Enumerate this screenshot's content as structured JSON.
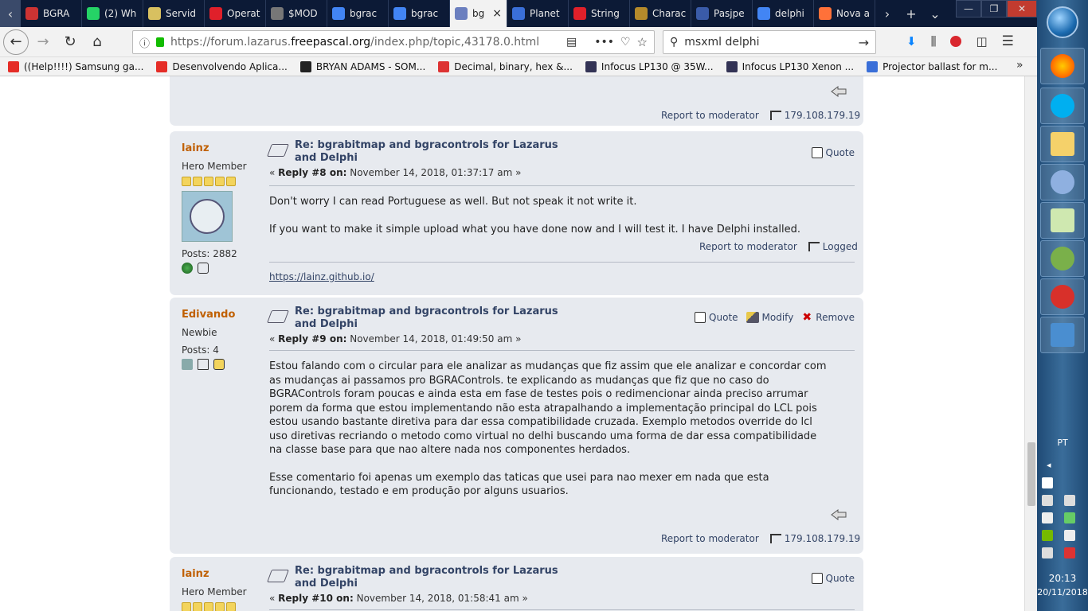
{
  "browser": {
    "tabs": [
      {
        "label": "BGRA",
        "color": "#c33"
      },
      {
        "label": "(2) Wh",
        "color": "#25d366"
      },
      {
        "label": "Servid",
        "color": "#d8c060"
      },
      {
        "label": "Operat",
        "color": "#e0202a"
      },
      {
        "label": "$MOD",
        "color": "#777"
      },
      {
        "label": "bgrac",
        "color": "#4285f4"
      },
      {
        "label": "bgrac",
        "color": "#4285f4"
      },
      {
        "label": "bg",
        "color": "#6b7fbf",
        "active": true
      },
      {
        "label": "Planet",
        "color": "#3a6fd8"
      },
      {
        "label": "String",
        "color": "#e0202a"
      },
      {
        "label": "Charac",
        "color": "#b58a2b"
      },
      {
        "label": "Pasjpe",
        "color": "#3a5ba8"
      },
      {
        "label": "delphi",
        "color": "#4285f4"
      },
      {
        "label": "Nova a",
        "color": "#ff7139"
      }
    ],
    "close_tab": "×",
    "new_tab": "+",
    "url_prefix": "https://forum.lazarus.",
    "url_domain": "freepascal.org",
    "url_suffix": "/index.php/topic,43178.0.html",
    "search_value": "msxml delphi",
    "bookmarks": [
      {
        "label": "((Help!!!!) Samsung ga...",
        "color": "#e52d27"
      },
      {
        "label": "Desenvolvendo Aplica...",
        "color": "#e52d27"
      },
      {
        "label": "BRYAN ADAMS - SOM...",
        "color": "#222"
      },
      {
        "label": "Decimal, binary, hex &...",
        "color": "#d33"
      },
      {
        "label": "Infocus LP130 @ 35W...",
        "color": "#335"
      },
      {
        "label": "Infocus LP130 Xenon ...",
        "color": "#335"
      },
      {
        "label": "Projector ballast for m...",
        "color": "#3a6fd8"
      }
    ]
  },
  "forum": {
    "top_report": "Report to moderator",
    "top_ip": "179.108.179.19",
    "posts": [
      {
        "name": "lainz",
        "rank": "Hero Member",
        "posts": "Posts: 2882",
        "subject": "Re: bgrabitmap and bgracontrols for Lazarus and Delphi",
        "reply_label": "Reply #8 on:",
        "reply_date": "November 14, 2018, 01:37:17 am",
        "quote": "Quote",
        "body1": "Don't worry I can read Portuguese as well. But not speak it not write it.",
        "body2": "If you want to make it simple upload what you have done now and I will test it. I have Delphi installed.",
        "report": "Report to moderator",
        "logged": "Logged",
        "signature": "https://lainz.github.io/"
      },
      {
        "name": "Edivando",
        "rank": "Newbie",
        "posts": "Posts: 4",
        "subject": "Re: bgrabitmap and bgracontrols for Lazarus and Delphi",
        "reply_label": "Reply #9 on:",
        "reply_date": "November 14, 2018, 01:49:50 am",
        "quote": "Quote",
        "modify": "Modify",
        "remove": "Remove",
        "body1": "Estou falando com o circular para ele analizar as mudanças que fiz assim que ele analizar e concordar com as mudanças ai passamos pro BGRAControls. te explicando as mudanças que fiz que no caso do BGRAControls foram poucas e ainda esta em fase de testes pois o redimencionar ainda preciso arrumar porem da forma que estou implementando não esta atrapalhando a implementação principal do LCL pois estou usando bastante diretiva para dar essa compatibilidade cruzada. Exemplo metodos override do lcl uso diretivas recriando o metodo como virtual no delhi buscando uma forma de dar essa compatibilidade na classe base para que nao altere nada nos componentes herdados.",
        "body2": "Esse comentario foi apenas um exemplo das taticas que usei para nao mexer em nada que esta funcionando, testado e em produção por alguns usuarios.",
        "report": "Report to moderator",
        "ip": "179.108.179.19"
      },
      {
        "name": "lainz",
        "rank": "Hero Member",
        "subject": "Re: bgrabitmap and bgracontrols for Lazarus and Delphi",
        "reply_label": "Reply #10 on:",
        "reply_date": "November 14, 2018, 01:58:41 am",
        "quote": "Quote"
      }
    ]
  },
  "taskbar": {
    "lang": "PT",
    "time": "20:13",
    "date": "20/11/2018"
  }
}
